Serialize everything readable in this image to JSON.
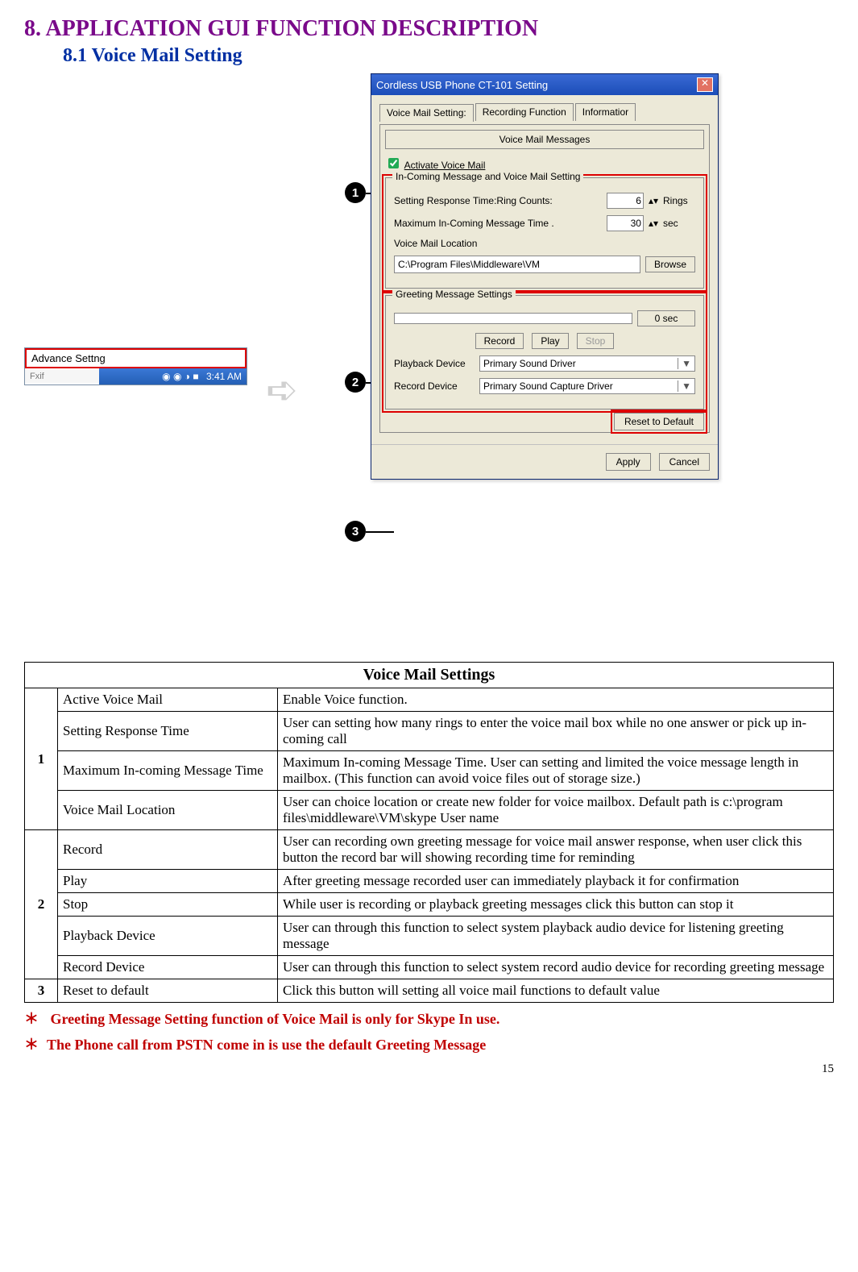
{
  "doc": {
    "heading": "8. APPLICATION GUI FUNCTION DESCRIPTION",
    "subheading": "8.1  Voice Mail Setting",
    "page_number": "15"
  },
  "adv_thumb": {
    "label": "Advance Settng",
    "fxif": "Fxif",
    "clock": "3:41 AM"
  },
  "bubbles": {
    "b1": "1",
    "b2": "2",
    "b3": "3"
  },
  "dialog": {
    "title": "Cordless USB Phone CT-101 Setting",
    "tabs": {
      "t1": "Voice Mail Setting:",
      "t2": "Recording Function",
      "t3": "Informatior"
    },
    "subtab": "Voice Mail Messages",
    "activate_label": "Activate Voice Mail",
    "group1": {
      "legend": "In-Coming Message and Voice Mail Setting",
      "resp_label": "Setting Response Time:Ring Counts:",
      "resp_value": "6",
      "resp_unit": "Rings",
      "max_label": "Maximum In-Coming Message Time .",
      "max_value": "30",
      "max_unit": "sec",
      "loc_label": "Voice Mail Location",
      "loc_value": "C:\\Program Files\\Middleware\\VM",
      "browse": "Browse"
    },
    "group2": {
      "legend": "Greeting Message Settings",
      "progress_unit": "0 sec",
      "record": "Record",
      "play": "Play",
      "stop": "Stop",
      "pb_label": "Playback Device",
      "pb_value": "Primary Sound Driver",
      "rec_label": "Record Device",
      "rec_value": "Primary Sound Capture Driver"
    },
    "reset_btn": "Reset to Default",
    "apply": "Apply",
    "cancel": "Cancel"
  },
  "table": {
    "header": "Voice Mail Settings",
    "sections": [
      {
        "num": "1",
        "rows": [
          {
            "name": "Active Voice Mail",
            "desc": "Enable Voice function."
          },
          {
            "name": "Setting Response Time",
            "desc": "User can setting how many rings to enter the voice mail box while no one answer or pick up in-coming call"
          },
          {
            "name": "Maximum In-coming Message Time",
            "desc": "Maximum In-coming Message Time. User can setting and limited the voice message length in mailbox. (This function can avoid voice files out of storage size.)"
          },
          {
            "name": "Voice Mail Location",
            "desc": "User can choice location or create new folder for voice mailbox. Default path is c:\\program files\\middleware\\VM\\skype User name"
          }
        ]
      },
      {
        "num": "2",
        "rows": [
          {
            "name": "Record",
            "desc": "User can recording own greeting message for voice mail answer response, when user click this button the record bar will showing recording time for reminding"
          },
          {
            "name": "Play",
            "desc": "After greeting message recorded user can immediately playback it for confirmation"
          },
          {
            "name": "Stop",
            "desc": "While user is recording or playback greeting messages click this button can stop it"
          },
          {
            "name": "Playback Device",
            "desc": "User can through this function to select system playback audio device for listening greeting message"
          },
          {
            "name": "Record Device",
            "desc": "User can through this function to select system record audio device for recording greeting message"
          }
        ]
      },
      {
        "num": "3",
        "rows": [
          {
            "name": "Reset to default",
            "desc": "Click this button will setting all voice mail functions to default value"
          }
        ]
      }
    ]
  },
  "notes": {
    "n1": "Greeting Message Setting function of Voice Mail is only for Skype In use.",
    "n2": "The Phone call from PSTN come in is use the default Greeting Message"
  }
}
